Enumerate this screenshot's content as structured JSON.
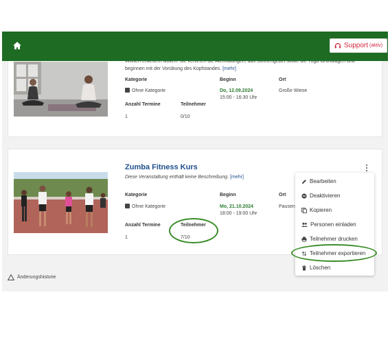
{
  "header": {
    "support_label": "Support",
    "support_status": "(aktiv)",
    "icons": [
      "home-icon",
      "headset-icon"
    ],
    "colors": {
      "bar": "#1e6b23",
      "support": "#d0253c"
    }
  },
  "card1": {
    "description": "Wissen erweitern wollen. Sie vertiefen die Atemübungen, das Sonnengebet sowie die Yoga-Grundlagen und beginnen mit der Vorübung des Kopfstandes.",
    "more": "[mehr]",
    "kategorie_label": "Kategorie",
    "kategorie_value": "Ohne Kategorie",
    "beginn_label": "Beginn",
    "beginn_date": "Do, 12.09.2024",
    "beginn_time": "15:00 - 16:30 Uhr",
    "ort_label": "Ort",
    "ort_value": "Große Wiese",
    "termine_label": "Anzahl Termine",
    "termine_value": "1",
    "teilnehmer_label": "Teilnehmer",
    "teilnehmer_value": "0/10"
  },
  "card2": {
    "title": "Zumba Fitness Kurs",
    "description": "Diese Veranstaltung enthält keine Beschreibung.",
    "more": "[mehr]",
    "kategorie_label": "Kategorie",
    "kategorie_value": "Ohne Kategorie",
    "beginn_label": "Beginn",
    "beginn_date": "Mo, 21.10.2024",
    "beginn_time": "18:00 - 19:00 Uhr",
    "ort_label": "Ort",
    "ort_value": "Pausen",
    "termine_label": "Anzahl Termine",
    "termine_value": "1",
    "teilnehmer_label": "Teilnehmer",
    "teilnehmer_value": "7/10"
  },
  "menu": {
    "items": [
      "Bearbeiten",
      "Deaktivieren",
      "Kopieren",
      "Personen einladen",
      "Teilnehmer drucken",
      "Teilnehmer exportieren",
      "Löschen"
    ]
  },
  "footer": {
    "history_label": "Änderungshistorie"
  },
  "highlight_color": "#3a8c28"
}
